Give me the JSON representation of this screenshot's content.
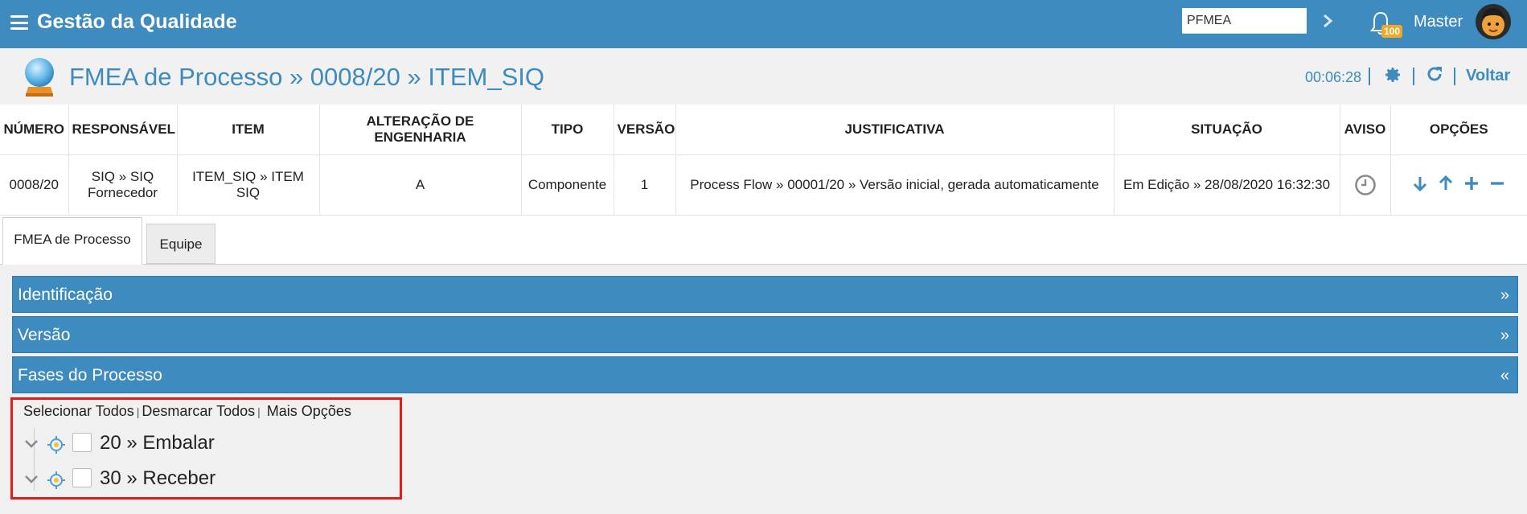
{
  "app": {
    "title": "Gestão da Qualidade"
  },
  "search": {
    "value": "PFMEA"
  },
  "notifications": {
    "count": "100"
  },
  "user": {
    "name": "Master"
  },
  "header": {
    "title": "FMEA de Processo » 0008/20 » ITEM_SIQ",
    "timer": "00:06:28",
    "back_label": "Voltar"
  },
  "table": {
    "headers": [
      "NÚMERO",
      "RESPONSÁVEL",
      "ITEM",
      "ALTERAÇÃO DE ENGENHARIA",
      "TIPO",
      "VERSÃO",
      "JUSTIFICATIVA",
      "SITUAÇÃO",
      "AVISO",
      "OPÇÕES"
    ],
    "row": {
      "numero": "0008/20",
      "responsavel_line1": "SIQ » SIQ",
      "responsavel_line2": "Fornecedor",
      "item": "ITEM_SIQ » ITEM SIQ",
      "alteracao": "A",
      "tipo": "Componente",
      "versao": "1",
      "justificativa": "Process Flow » 00001/20 » Versão inicial, gerada automaticamente",
      "situacao": "Em Edição » 28/08/2020 16:32:30"
    }
  },
  "tabs": [
    {
      "label": "FMEA de Processo",
      "active": true
    },
    {
      "label": "Equipe",
      "active": false
    }
  ],
  "panels": [
    {
      "label": "Identificação",
      "chevron": "»"
    },
    {
      "label": "Versão",
      "chevron": "»"
    },
    {
      "label": "Fases do Processo",
      "chevron": "«"
    }
  ],
  "tree": {
    "select_all": "Selecionar Todos",
    "deselect_all": "Desmarcar Todos",
    "more_options": "Mais Opções",
    "separator": "|",
    "items": [
      {
        "label": "20 » Embalar",
        "checked": false
      },
      {
        "label": "30 » Receber",
        "checked": false
      }
    ]
  },
  "colors": {
    "accent": "#3d8bbf",
    "highlight": "#e51a1a",
    "badge": "#f5a623"
  }
}
